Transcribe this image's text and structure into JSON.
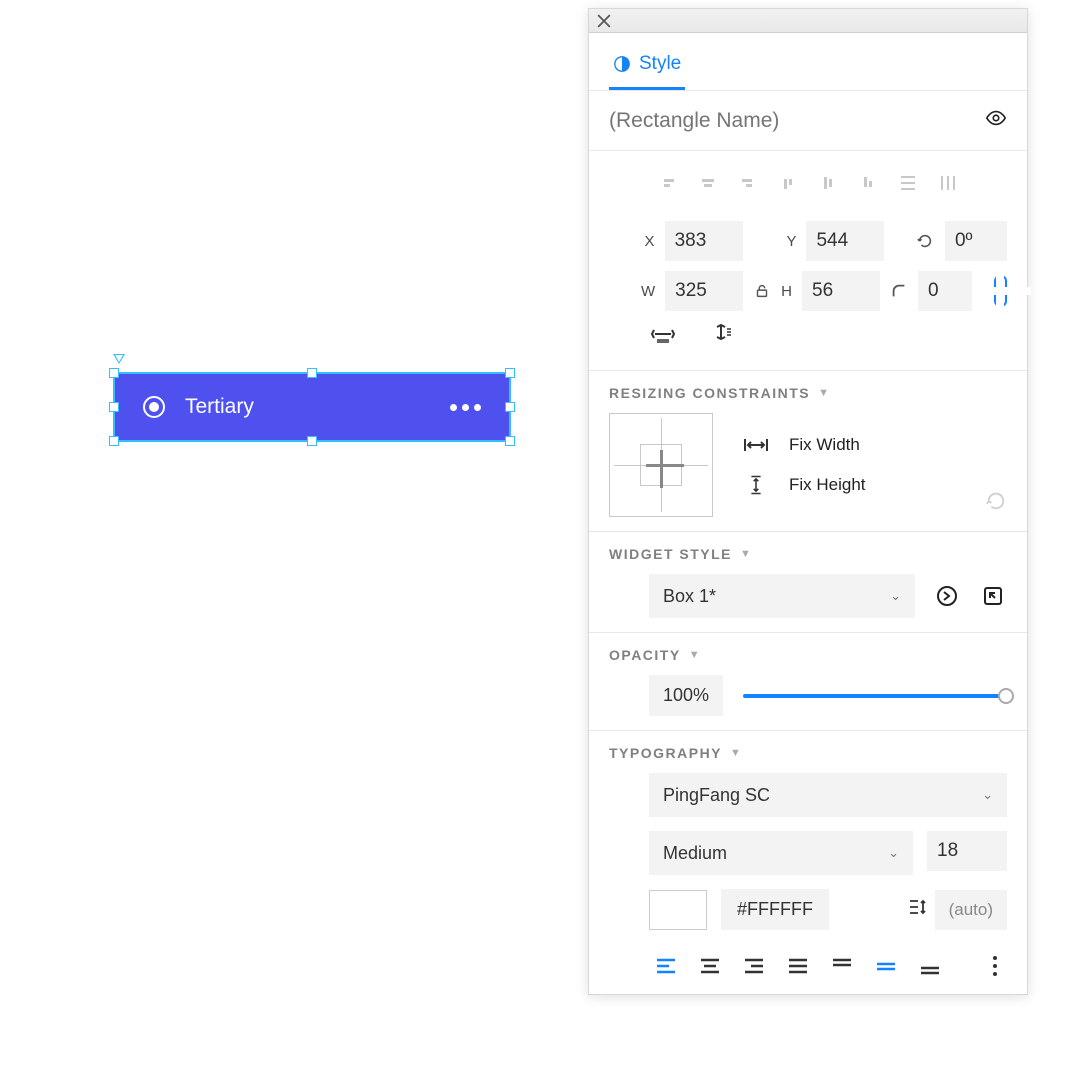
{
  "canvas": {
    "widget_label": "Tertiary"
  },
  "panel": {
    "tab_style": "Style",
    "name_placeholder": "(Rectangle Name)",
    "geom": {
      "x_label": "X",
      "x": "383",
      "y_label": "Y",
      "y": "544",
      "rot_label": "0º",
      "w_label": "W",
      "w": "325",
      "h_label": "H",
      "h": "56",
      "radius": "0"
    },
    "constraints": {
      "title": "RESIZING CONSTRAINTS",
      "fix_width": "Fix Width",
      "fix_height": "Fix Height"
    },
    "widget_style": {
      "title": "WIDGET STYLE",
      "value": "Box 1*"
    },
    "opacity": {
      "title": "OPACITY",
      "value": "100%"
    },
    "typography": {
      "title": "TYPOGRAPHY",
      "font": "PingFang SC",
      "weight": "Medium",
      "size": "18",
      "color": "#FFFFFF",
      "line_height": "(auto)"
    }
  }
}
